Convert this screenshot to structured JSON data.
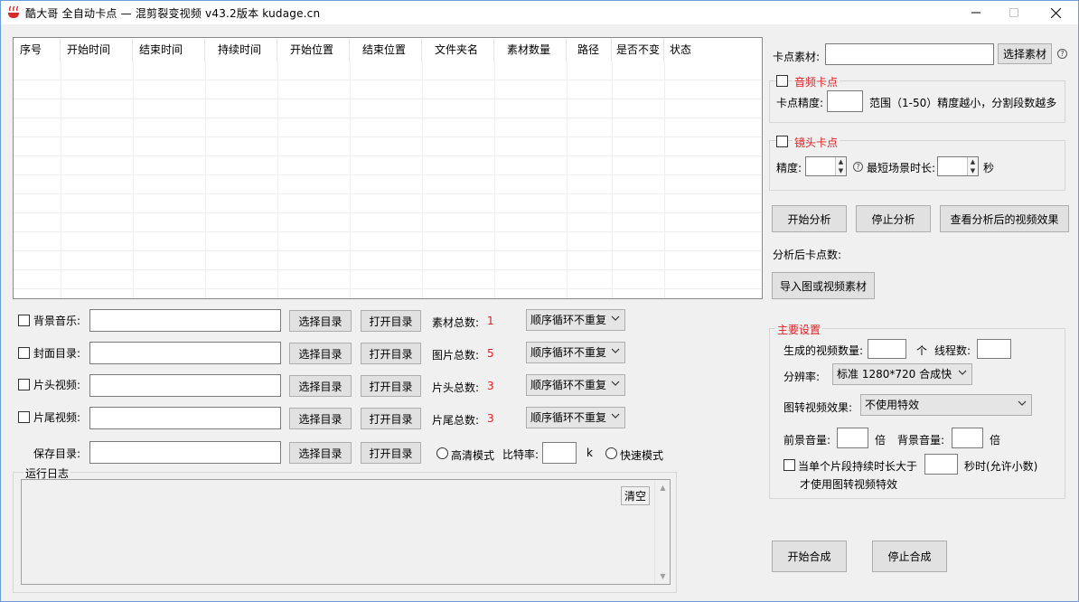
{
  "window": {
    "title": "酷大哥   全自动卡点 — 混剪裂变视频   v43.2版本   kudage.cn",
    "minimize_icon": "minimize-icon",
    "maximize_icon": "maximize-icon",
    "close_icon": "close-icon"
  },
  "grid": {
    "columns": [
      "序号",
      "开始时间",
      "结束时间",
      "持续时间",
      "开始位置",
      "结束位置",
      "文件夹名",
      "素材数量",
      "路径",
      "是否不变",
      "状态"
    ]
  },
  "rows": {
    "bgm": {
      "label": "背景音乐:",
      "select": "选择目录",
      "open": "打开目录",
      "stat_label": "素材总数:",
      "stat_value": "1",
      "mode": "顺序循环不重复"
    },
    "cover": {
      "label": "封面目录:",
      "select": "选择目录",
      "open": "打开目录",
      "stat_label": "图片总数:",
      "stat_value": "5",
      "mode": "顺序循环不重复"
    },
    "head": {
      "label": "片头视频:",
      "select": "选择目录",
      "open": "打开目录",
      "stat_label": "片头总数:",
      "stat_value": "3",
      "mode": "顺序循环不重复"
    },
    "tail": {
      "label": "片尾视频:",
      "select": "选择目录",
      "open": "打开目录",
      "stat_label": "片尾总数:",
      "stat_value": "3",
      "mode": "顺序循环不重复"
    },
    "save": {
      "label": "保存目录:",
      "select": "选择目录",
      "open": "打开目录",
      "hd_label": "高清模式",
      "bitrate_label": "比特率:",
      "bitrate_unit": "k",
      "fast_label": "快速模式"
    }
  },
  "log": {
    "title": "运行日志",
    "clear": "清空"
  },
  "right": {
    "material_label": "卡点素材:",
    "material_button": "选择素材",
    "audio": {
      "title": "音频卡点",
      "precision_label": "卡点精度:",
      "hint": "范围（1-50）精度越小，分割段数越多"
    },
    "shot": {
      "title": "镜头卡点",
      "precision_label": "精度:",
      "min_label": "最短场景时长:",
      "unit": "秒"
    },
    "start_analyze": "开始分析",
    "stop_analyze": "停止分析",
    "view_result": "查看分析后的视频效果",
    "count_label": "分析后卡点数:",
    "import_button": "导入图或视频素材",
    "main": {
      "title": "主要设置",
      "gen_count_label": "生成的视频数量:",
      "gen_count_unit": "个",
      "threads_label": "线程数:",
      "resolution_label": "分辨率:",
      "resolution_value": "标准 1280*720 合成快",
      "effect_label": "图转视频效果:",
      "effect_value": "不使用特效",
      "fg_volume_label": "前景音量:",
      "fg_volume_unit": "倍",
      "bg_volume_label": "背景音量:",
      "bg_volume_unit": "倍",
      "duration_check_label": "当单个片段持续时长大于",
      "duration_unit": "秒时(允许小数)",
      "duration_line2": "才使用图转视频特效"
    },
    "start_compose": "开始合成",
    "stop_compose": "停止合成"
  },
  "colors": {
    "accent_red": "#e02020",
    "window_border": "#6b9bd8"
  }
}
